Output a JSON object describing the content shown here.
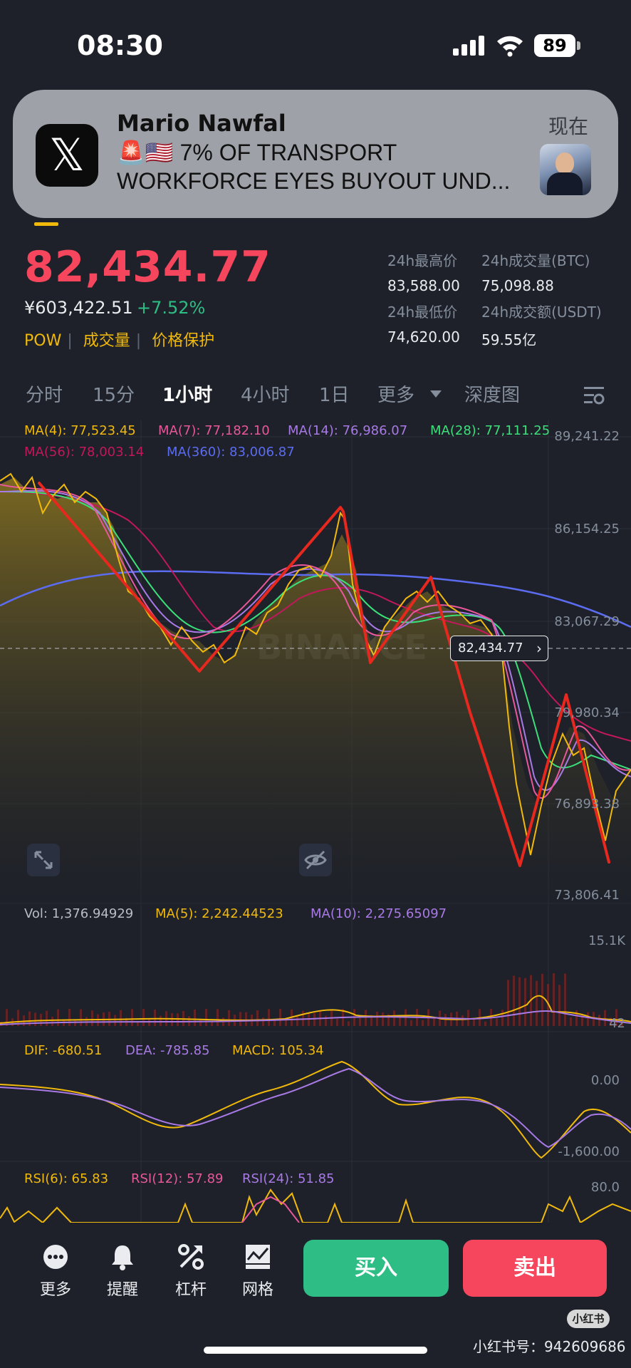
{
  "status_bar": {
    "time": "08:30",
    "battery": "89"
  },
  "notification": {
    "app_icon": "𝕏",
    "title": "Mario Nawfal",
    "body_line1": "🚨🇺🇸 7% OF TRANSPORT",
    "body_line2": "WORKFORCE EYES BUYOUT UND...",
    "time": "现在"
  },
  "ticker": {
    "price": "82,434.77",
    "price_cny": "¥603,422.51",
    "change": "+7.52%",
    "tags": [
      "POW",
      "成交量",
      "价格保护"
    ],
    "stats": [
      {
        "label": "24h最高价",
        "value": "83,588.00"
      },
      {
        "label": "24h成交量(BTC)",
        "value": "75,098.88"
      },
      {
        "label": "24h最低价",
        "value": "74,620.00"
      },
      {
        "label": "24h成交额(USDT)",
        "value": "59.55亿"
      }
    ]
  },
  "timeframes": [
    "分时",
    "15分",
    "1小时",
    "4小时",
    "1日",
    "更多",
    "深度图"
  ],
  "active_timeframe": "1小时",
  "main_chart": {
    "ma_legends": [
      {
        "label": "MA(4): 77,523.45",
        "color": "#f0b90b"
      },
      {
        "label": "MA(7): 77,182.10",
        "color": "#e9579b"
      },
      {
        "label": "MA(14): 76,986.07",
        "color": "#a87ae6"
      },
      {
        "label": "MA(28): 77,111.25",
        "color": "#3ce07a"
      },
      {
        "label": "MA(56): 78,003.14",
        "color": "#c2185b"
      },
      {
        "label": "MA(360): 83,006.87",
        "color": "#5b6cf0"
      }
    ],
    "y_axis": [
      "89,241.22",
      "86,154.25",
      "83,067.29",
      "79,980.34",
      "76,893.38",
      "73,806.41"
    ],
    "last_price_tag": "82,434.77",
    "watermark": "BINANCE"
  },
  "volume_panel": {
    "labels": [
      {
        "label": "Vol: 1,376.94929",
        "color": "#b7bdc6"
      },
      {
        "label": "MA(5): 2,242.44523",
        "color": "#f0b90b"
      },
      {
        "label": "MA(10): 2,275.65097",
        "color": "#a87ae6"
      }
    ],
    "y_axis": [
      "15.1K",
      "42"
    ]
  },
  "macd_panel": {
    "labels": [
      {
        "label": "DIF: -680.51",
        "color": "#f0b90b"
      },
      {
        "label": "DEA: -785.85",
        "color": "#a87ae6"
      },
      {
        "label": "MACD: 105.34",
        "color": "#f0b90b"
      }
    ],
    "y_axis": [
      "0.00",
      "-1,600.00"
    ]
  },
  "rsi_panel": {
    "labels": [
      {
        "label": "RSI(6): 65.83",
        "color": "#f0b90b"
      },
      {
        "label": "RSI(12): 57.89",
        "color": "#e9579b"
      },
      {
        "label": "RSI(24): 51.85",
        "color": "#a87ae6"
      }
    ],
    "y_axis": [
      "80.0"
    ]
  },
  "bottom_nav": {
    "items": [
      {
        "label": "更多",
        "icon": "more-icon"
      },
      {
        "label": "提醒",
        "icon": "bell-icon"
      },
      {
        "label": "杠杆",
        "icon": "leverage-icon"
      },
      {
        "label": "网格",
        "icon": "grid-icon"
      }
    ],
    "buy": "买入",
    "sell": "卖出"
  },
  "watermark": {
    "badge": "小红书",
    "id": "小红书号：942609686"
  },
  "colors": {
    "up": "#2ebd85",
    "down": "#f6465d",
    "accent": "#f0b90b",
    "bg": "#1e2129"
  }
}
